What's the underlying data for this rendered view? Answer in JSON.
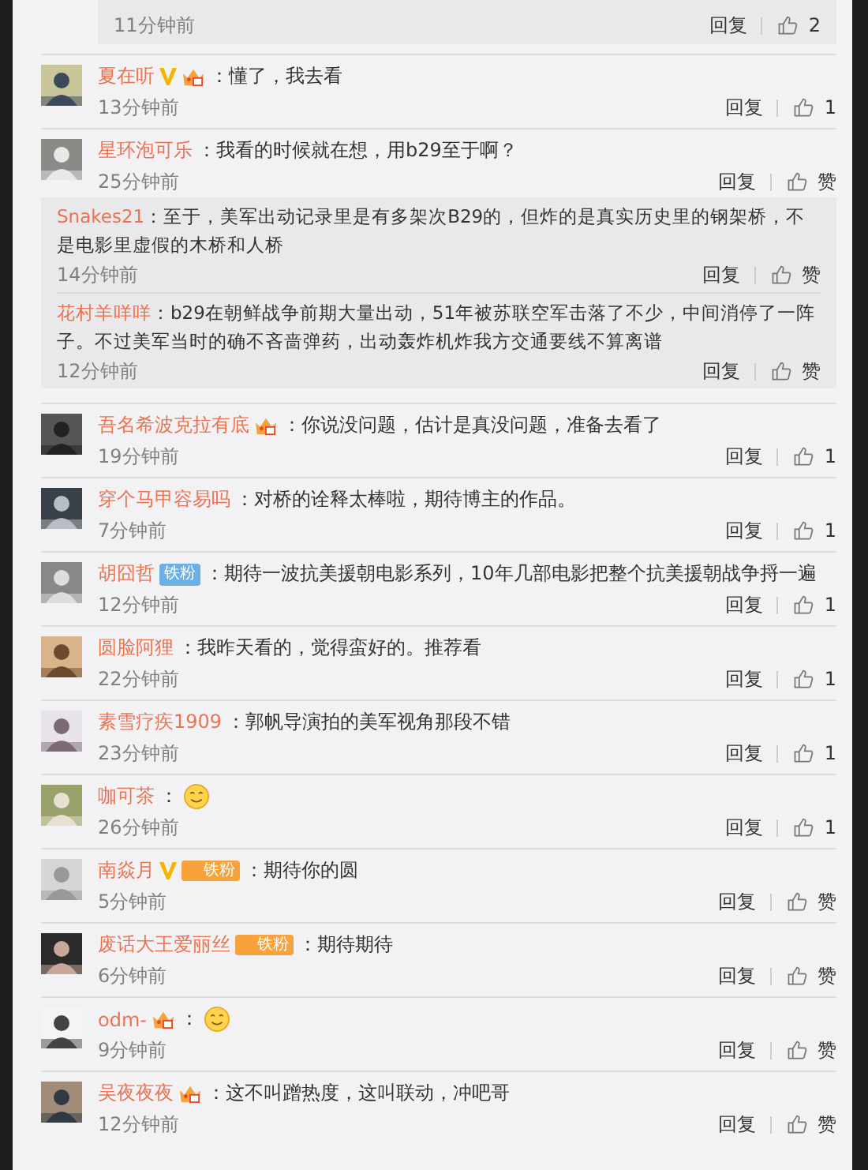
{
  "top_reply": {
    "time": "11分钟前",
    "reply": "回复",
    "likes": "2"
  },
  "comments": [
    {
      "name": "夏在听",
      "badges": [
        {
          "kind": "verified"
        },
        {
          "kind": "vip"
        }
      ],
      "text": "：懂了，我去看",
      "time": "13分钟前",
      "reply": "回复",
      "likes": "1"
    },
    {
      "name": "星环泡可乐",
      "text": "：我看的时候就在想，用b29至于啊？",
      "time": "25分钟前",
      "reply": "回复",
      "likes": "赞",
      "replies": [
        {
          "name": "Snakes21",
          "text": "：至于，美军出动记录里是有多架次B29的，但炸的是真实历史里的钢架桥，不是电影里虚假的木桥和人桥",
          "time": "14分钟前",
          "reply": "回复",
          "likes": "赞"
        },
        {
          "name": "花村羊咩咩",
          "text": "：b29在朝鲜战争前期大量出动，51年被苏联空军击落了不少，中间消停了一阵子。不过美军当时的确不吝啬弹药，出动轰炸机炸我方交通要线不算离谱",
          "time": "12分钟前",
          "reply": "回复",
          "likes": "赞"
        }
      ]
    },
    {
      "name": "吾名希波克拉有底",
      "badges": [
        {
          "kind": "vip"
        }
      ],
      "text": "：你说没问题，估计是真没问题，准备去看了",
      "time": "19分钟前",
      "reply": "回复",
      "likes": "1"
    },
    {
      "name": "穿个马甲容易吗",
      "text": "：对桥的诠释太棒啦，期待博主的作品。",
      "time": "7分钟前",
      "reply": "回复",
      "likes": "1"
    },
    {
      "name": "胡囧哲",
      "badges": [
        {
          "kind": "fan",
          "label": "铁粉"
        }
      ],
      "text": "：期待一波抗美援朝电影系列，10年几部电影把整个抗美援朝战争捋一遍",
      "time": "12分钟前",
      "reply": "回复",
      "likes": "1"
    },
    {
      "name": "圆脸阿狸",
      "text": "：我昨天看的，觉得蛮好的。推荐看",
      "time": "22分钟前",
      "reply": "回复",
      "likes": "1"
    },
    {
      "name": "素雪疗疾1909",
      "text": "：郭帆导演拍的美军视角那段不错",
      "time": "23分钟前",
      "reply": "回复",
      "likes": "1"
    },
    {
      "name": "咖可茶",
      "text": "：",
      "sticker": true,
      "time": "26分钟前",
      "reply": "回复",
      "likes": "1"
    },
    {
      "name": "南焱月",
      "badges": [
        {
          "kind": "verified"
        },
        {
          "kind": "vip_fan",
          "label": "铁粉"
        }
      ],
      "text": "：期待你的圆",
      "time": "5分钟前",
      "reply": "回复",
      "likes": "赞"
    },
    {
      "name": "废话大王爱丽丝",
      "badges": [
        {
          "kind": "vip_fan",
          "label": "铁粉"
        }
      ],
      "text": "：期待期待",
      "time": "6分钟前",
      "reply": "回复",
      "likes": "赞"
    },
    {
      "name": "odm-",
      "badges": [
        {
          "kind": "vip"
        }
      ],
      "text": "：",
      "sticker": true,
      "time": "9分钟前",
      "reply": "回复",
      "likes": "赞"
    },
    {
      "name": "吴夜夜夜",
      "badges": [
        {
          "kind": "vip"
        }
      ],
      "text": "：这不叫蹭热度，这叫联动，冲吧哥",
      "time": "12分钟前",
      "reply": "回复",
      "likes": "赞"
    }
  ]
}
